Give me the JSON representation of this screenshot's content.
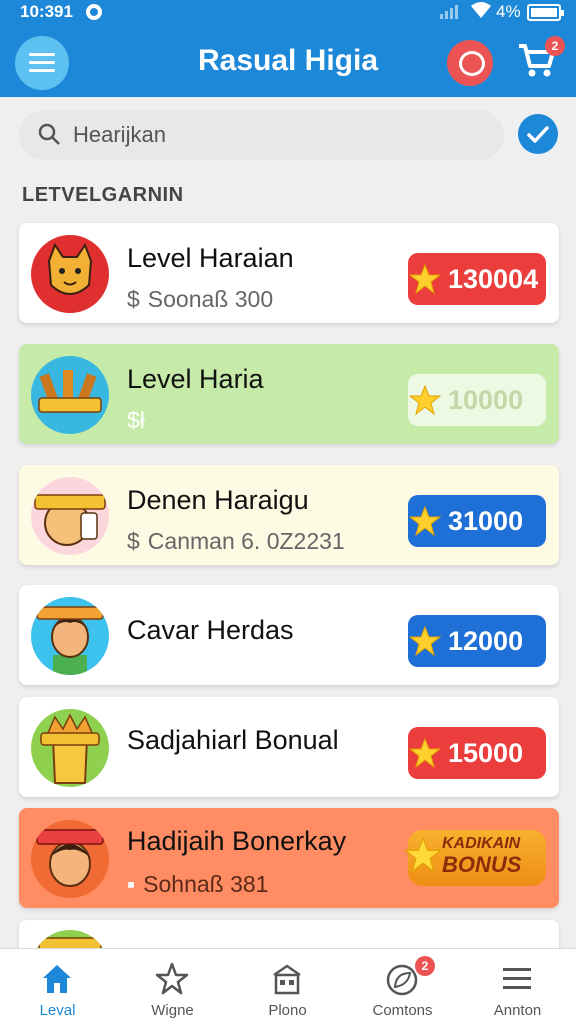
{
  "status_bar": {
    "time": "10:391",
    "battery": "4%"
  },
  "header": {
    "title": "Rasual Higia",
    "cart_badge": "2"
  },
  "search": {
    "placeholder": "Hearijkan"
  },
  "section": {
    "title": "LETVELGARNIN"
  },
  "items": [
    {
      "title": "Level Haraian",
      "subtitle": "Soonaß 300",
      "currency": "$",
      "reward": "130004",
      "badge_style": "red",
      "card_color": "#ffffff",
      "avatar": "fox-avatar-icon"
    },
    {
      "title": "Level Haria",
      "subtitle": "$ł",
      "currency": "$",
      "reward": "10000",
      "badge_style": "pale",
      "card_color": "#c6eaa8",
      "avatar": "wood-badge-avatar-icon"
    },
    {
      "title": "Denen Haraigu",
      "subtitle": "Canman 6. 0Z2231",
      "currency": "$",
      "reward": "31000",
      "badge_style": "blue",
      "card_color": "#fdfbe3",
      "avatar": "cartoon-avatar-icon"
    },
    {
      "title": "Cavar Herdas",
      "subtitle": "",
      "currency": "",
      "reward": "12000",
      "badge_style": "blue",
      "card_color": "#ffffff",
      "avatar": "boy-avatar-icon"
    },
    {
      "title": "Sadjahiarl Bonual",
      "subtitle": "",
      "currency": "",
      "reward": "15000",
      "badge_style": "red",
      "card_color": "#ffffff",
      "avatar": "crown-avatar-icon"
    },
    {
      "title": "Hadijaih Bonerkay",
      "subtitle": "Sohnaß 381",
      "currency": "▪",
      "reward_top": "KADIKAIN",
      "reward_bottom": "BONUS",
      "badge_style": "orange",
      "card_color": "#ff8c62",
      "avatar": "kid-avatar-icon"
    }
  ],
  "bottom_nav": [
    {
      "label": "Leval",
      "icon": "home-icon",
      "active": true
    },
    {
      "label": "Wigne",
      "icon": "star-icon",
      "active": false
    },
    {
      "label": "Plono",
      "icon": "store-icon",
      "active": false
    },
    {
      "label": "Comtons",
      "icon": "leaf-icon",
      "active": false,
      "badge": "2"
    },
    {
      "label": "Annton",
      "icon": "menu-icon",
      "active": false
    }
  ],
  "colors": {
    "primary": "#1e88d8",
    "red": "#ec3d3d",
    "blue": "#1e6fd6",
    "orange": "#f29b22"
  }
}
